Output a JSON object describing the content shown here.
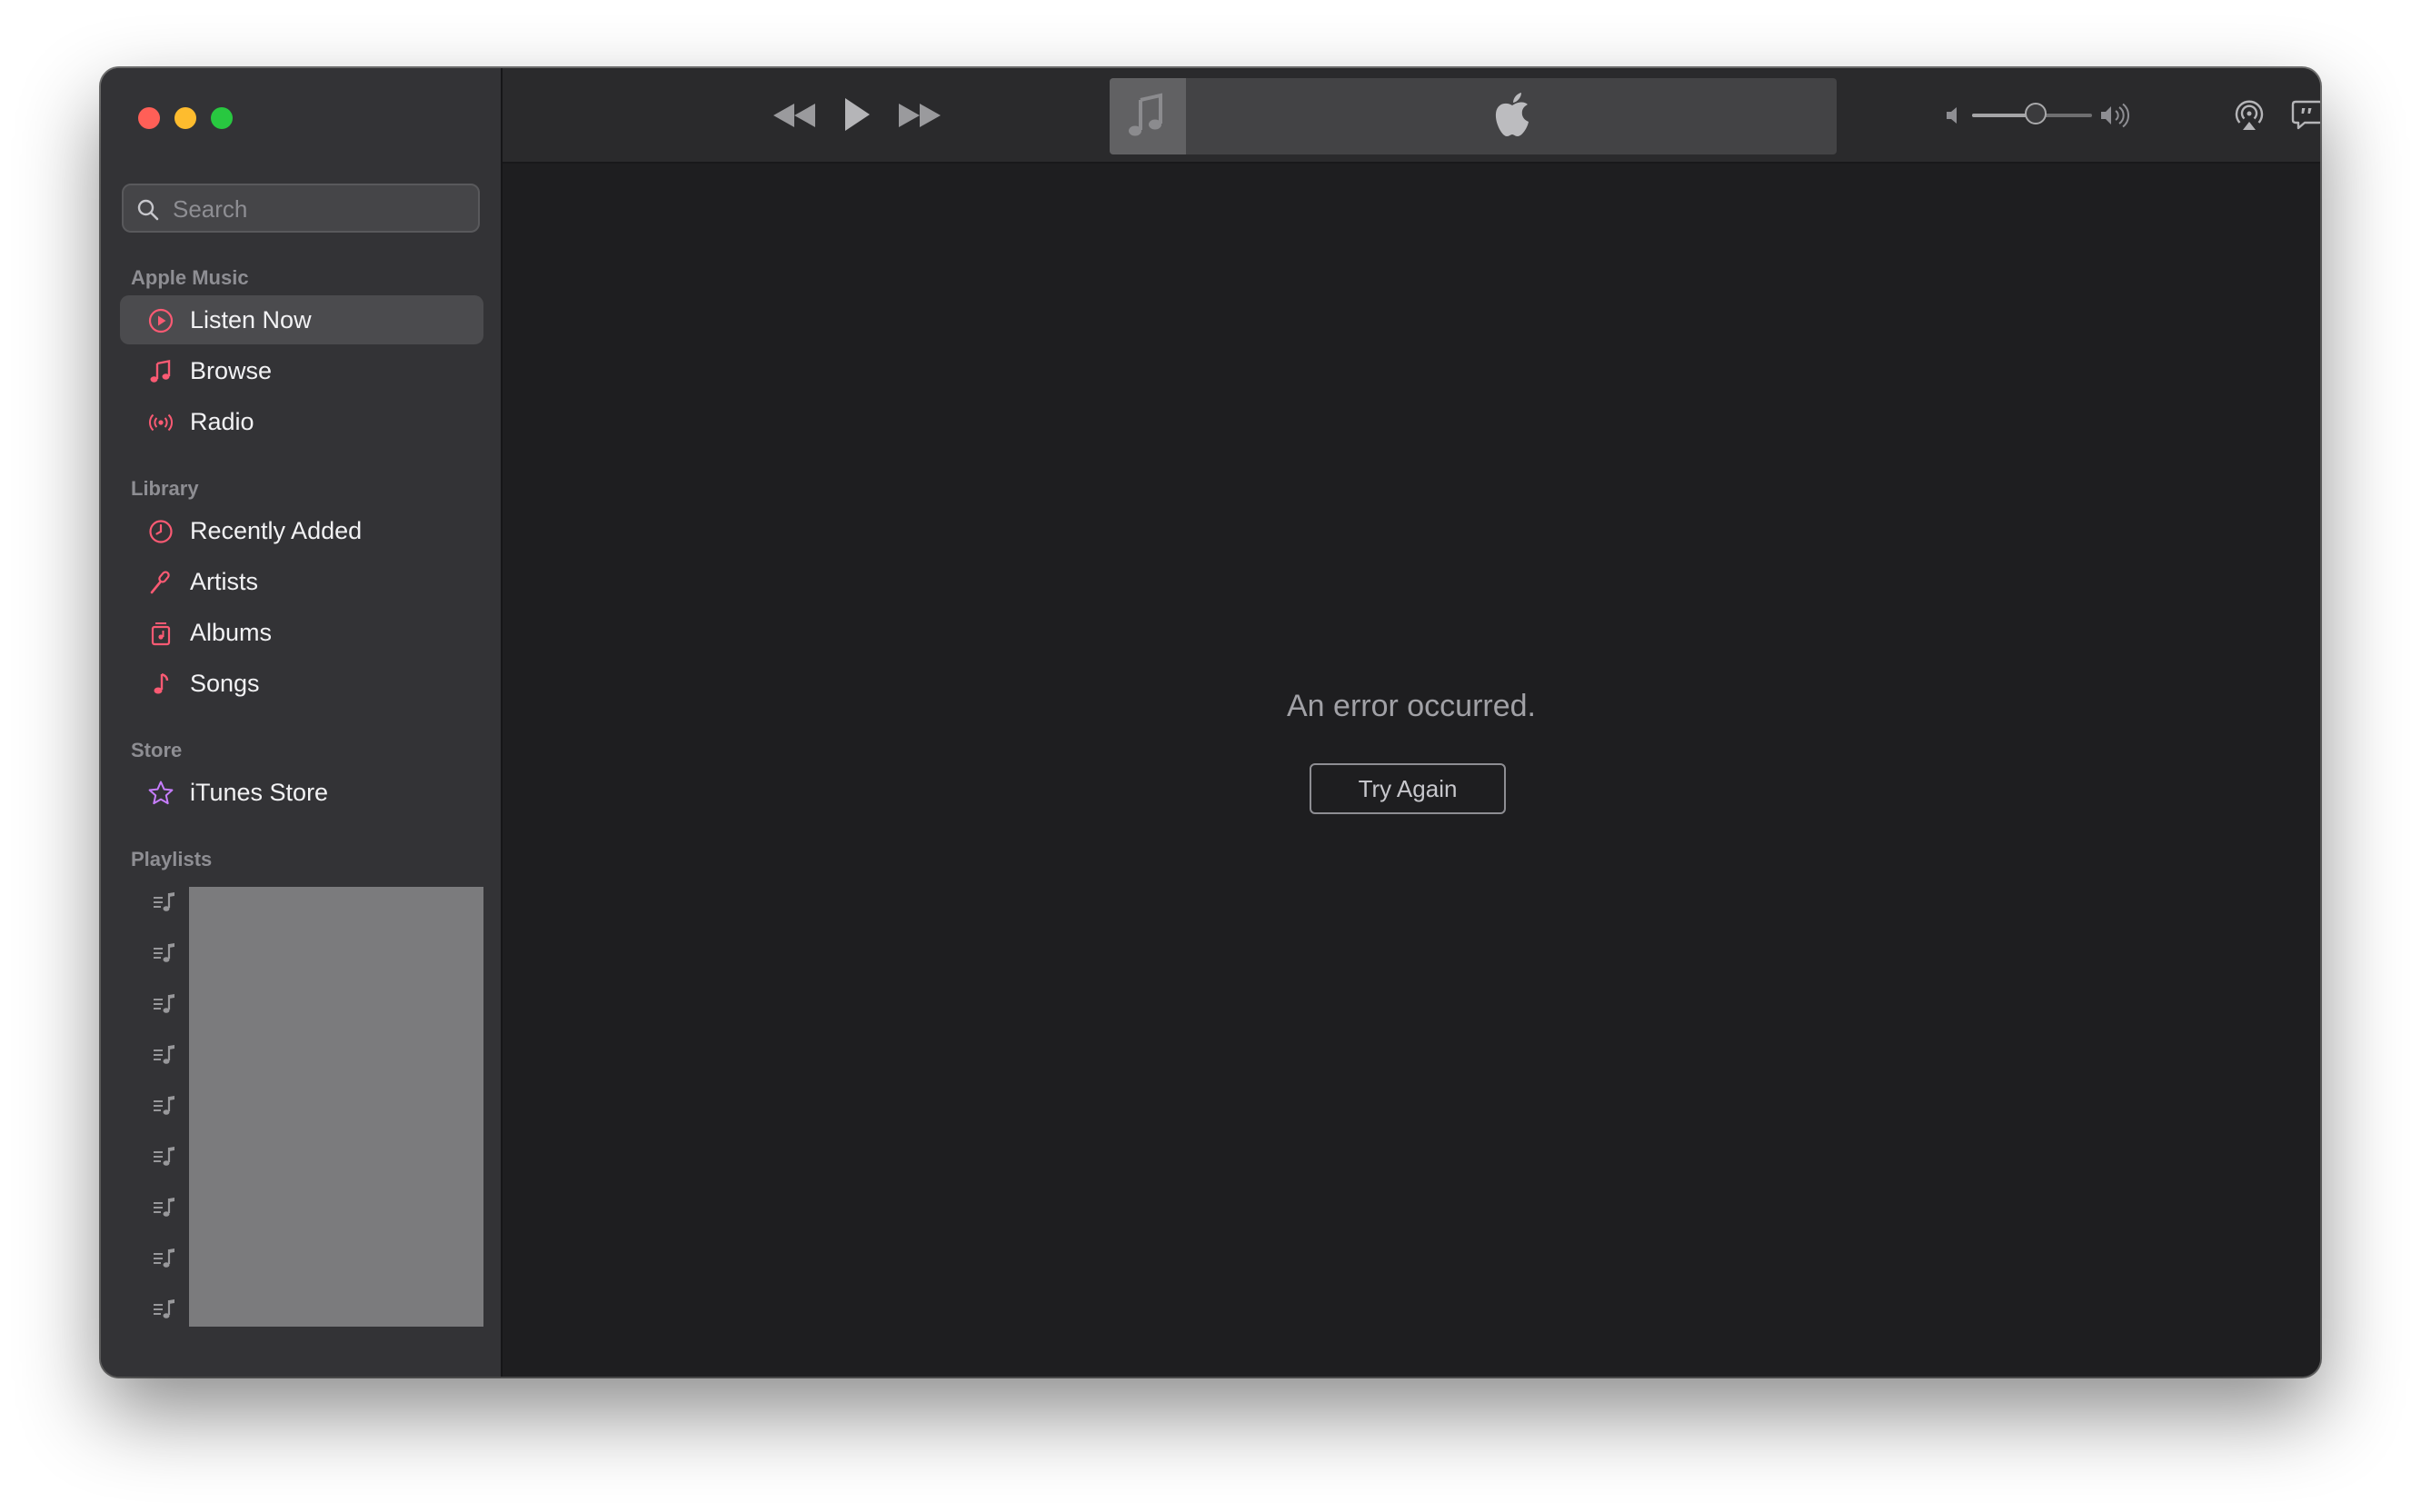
{
  "sidebar": {
    "search": {
      "placeholder": "Search",
      "value": ""
    },
    "sections": {
      "apple_music": "Apple Music",
      "library": "Library",
      "store": "Store",
      "playlists": "Playlists"
    },
    "apple_music_items": [
      {
        "label": "Listen Now",
        "icon": "play-circle-icon",
        "selected": true
      },
      {
        "label": "Browse",
        "icon": "music-note-icon"
      },
      {
        "label": "Radio",
        "icon": "radio-waves-icon"
      }
    ],
    "library_items": [
      {
        "label": "Recently Added",
        "icon": "clock-icon"
      },
      {
        "label": "Artists",
        "icon": "microphone-icon"
      },
      {
        "label": "Albums",
        "icon": "album-icon"
      },
      {
        "label": "Songs",
        "icon": "music-note-icon"
      }
    ],
    "store_items": [
      {
        "label": "iTunes Store",
        "icon": "star-icon"
      }
    ],
    "playlist_count": 9
  },
  "player": {
    "volume": 0.53
  },
  "main": {
    "error_message": "An error occurred.",
    "retry_label": "Try Again"
  },
  "colors": {
    "accent": "#fa5a73",
    "store_accent": "#c77dff",
    "sidebar_bg": "#333336",
    "main_bg": "#1e1e20"
  }
}
